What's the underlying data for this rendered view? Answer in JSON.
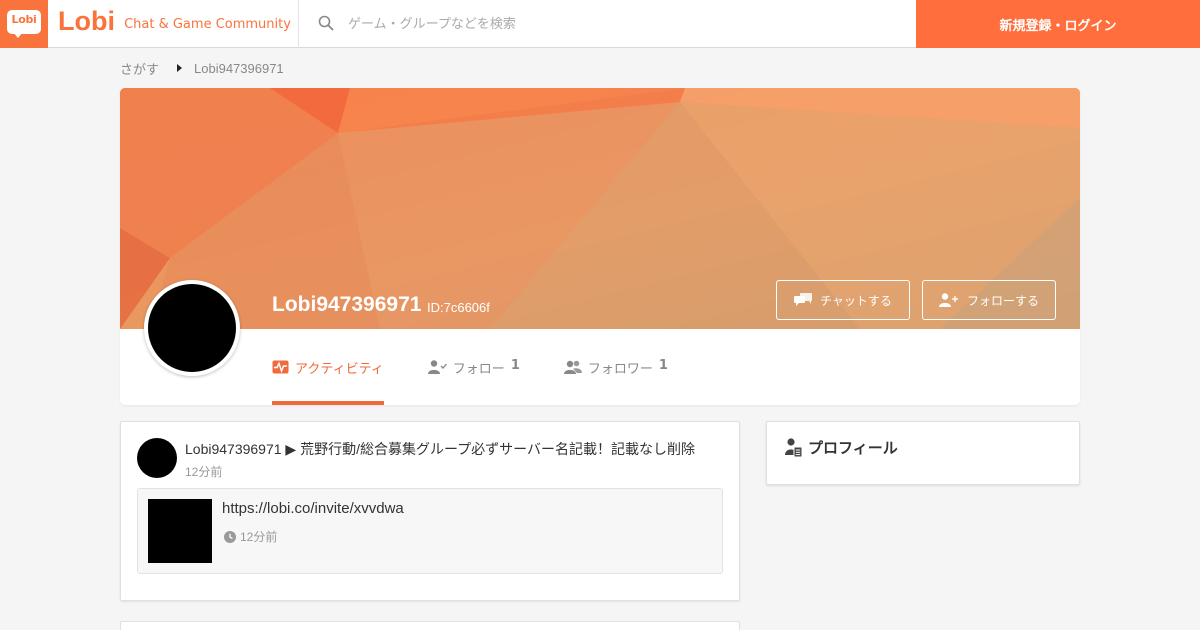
{
  "header": {
    "logo_text": "Lobi",
    "brand_name": "Lobi",
    "brand_tagline": "Chat & Game Community",
    "search_placeholder": "ゲーム・グループなどを検索",
    "login_label": "新規登録・ログイン"
  },
  "breadcrumb": {
    "items": [
      "さがす",
      "Lobi947396971"
    ]
  },
  "profile": {
    "name": "Lobi947396971",
    "id_label": "ID:7c6606f",
    "chat_button": "チャットする",
    "follow_button": "フォローする",
    "tabs": [
      {
        "label": "アクティビティ",
        "count": "",
        "icon": "activity-icon",
        "active": true
      },
      {
        "label": "フォロー",
        "count": "1",
        "icon": "user-check-icon",
        "active": false
      },
      {
        "label": "フォロワー",
        "count": "1",
        "icon": "users-icon",
        "active": false
      }
    ]
  },
  "activity": {
    "title": "Lobi947396971 ▶ 荒野行動/総合募集グループ必ずサーバー名記載！記載なし削除",
    "time": "12分前",
    "link_url": "https://lobi.co/invite/xvvdwa",
    "link_time": "12分前"
  },
  "side": {
    "profile_title": "プロフィール"
  },
  "colors": {
    "accent": "#f9733d",
    "login_bg": "#ff6e3c",
    "tab_active": "#f06a3c"
  }
}
